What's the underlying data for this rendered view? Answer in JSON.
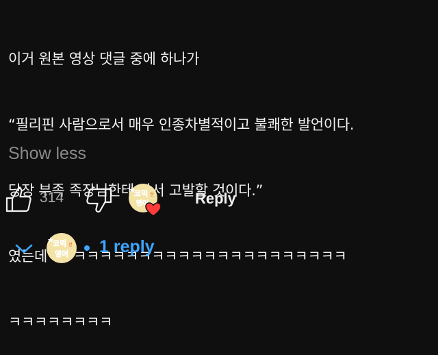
{
  "comment": {
    "lines": [
      "이거 원본 영상 댓글 중에 하나가",
      "“필리핀 사람으로서 매우 인종차별적이고 불쾌한 발언이다.",
      "당장 부족 족장님한테 가서 고발할 것이다.”",
      "였는데ㅋㅋㅋㅋㅋㅋㅋㅋㅋㅋㅋㅋㅋㅋㅋㅋㅋㅋㅋㅋㅋㅋㅋ",
      "ㅋㅋㅋㅋㅋㅋㅋㅋ"
    ],
    "show_less_label": "Show less"
  },
  "actions": {
    "like_icon": "thumbs-up-icon",
    "like_count": "314",
    "dislike_icon": "thumbs-down-icon",
    "heart_color": "#ff3b3b",
    "reply_label": "Reply"
  },
  "channel_avatar": {
    "logo_text_top": "코믹",
    "logo_text_small": "한",
    "logo_text_bottom": "영어"
  },
  "replies": {
    "chevron_icon": "chevron-down-icon",
    "link_label": "1 reply",
    "accent": "#3ea6ff"
  }
}
